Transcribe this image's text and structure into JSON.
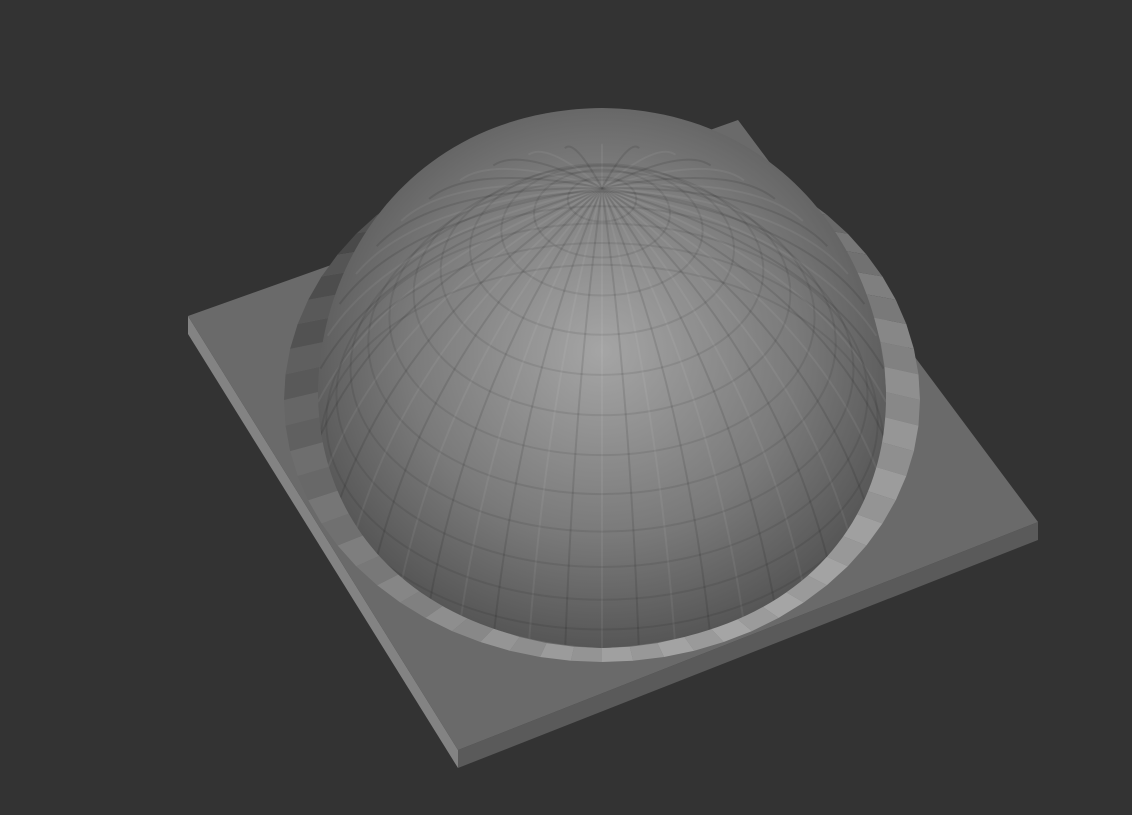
{
  "viewport": {
    "background_color": "#333333",
    "model": {
      "base_plate": {
        "shape": "square-plate",
        "top_color": "#6a6a6a",
        "front_edge_color": "#838383",
        "right_edge_color": "#5a5a5a"
      },
      "dome": {
        "shape": "faceted-hemisphere",
        "highlight_color": "#a5a5a5",
        "mid_color": "#7a7a7a",
        "shadow_color": "#4a4a4a"
      }
    }
  }
}
